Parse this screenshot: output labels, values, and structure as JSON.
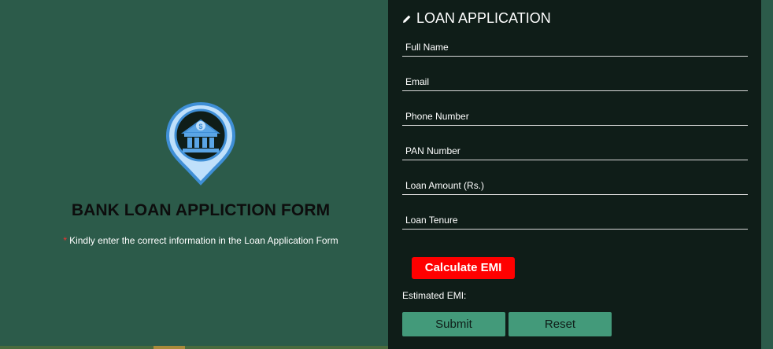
{
  "left": {
    "title": "BANK LOAN APPLICTION FORM",
    "required_mark": "*",
    "subtitle": "Kindly enter the correct information in the Loan Application Form"
  },
  "form": {
    "heading": "LOAN APPLICATION",
    "fields": [
      {
        "label": "Full Name"
      },
      {
        "label": "Email"
      },
      {
        "label": "Phone Number"
      },
      {
        "label": "PAN Number"
      },
      {
        "label": "Loan Amount (Rs.)"
      },
      {
        "label": "Loan Tenure"
      }
    ],
    "calculate_label": "Calculate EMI",
    "emi_label": "Estimated EMI:",
    "submit_label": "Submit",
    "reset_label": "Reset"
  },
  "colors": {
    "background": "#2c5b4a",
    "panel": "#0f1d18",
    "accent_green": "#439a7a",
    "calculate_red": "#ff0000",
    "logo_blue": "#5aa5e6"
  },
  "icons": {
    "logo": "bank-location-pin-icon",
    "heading": "pencil-icon"
  }
}
